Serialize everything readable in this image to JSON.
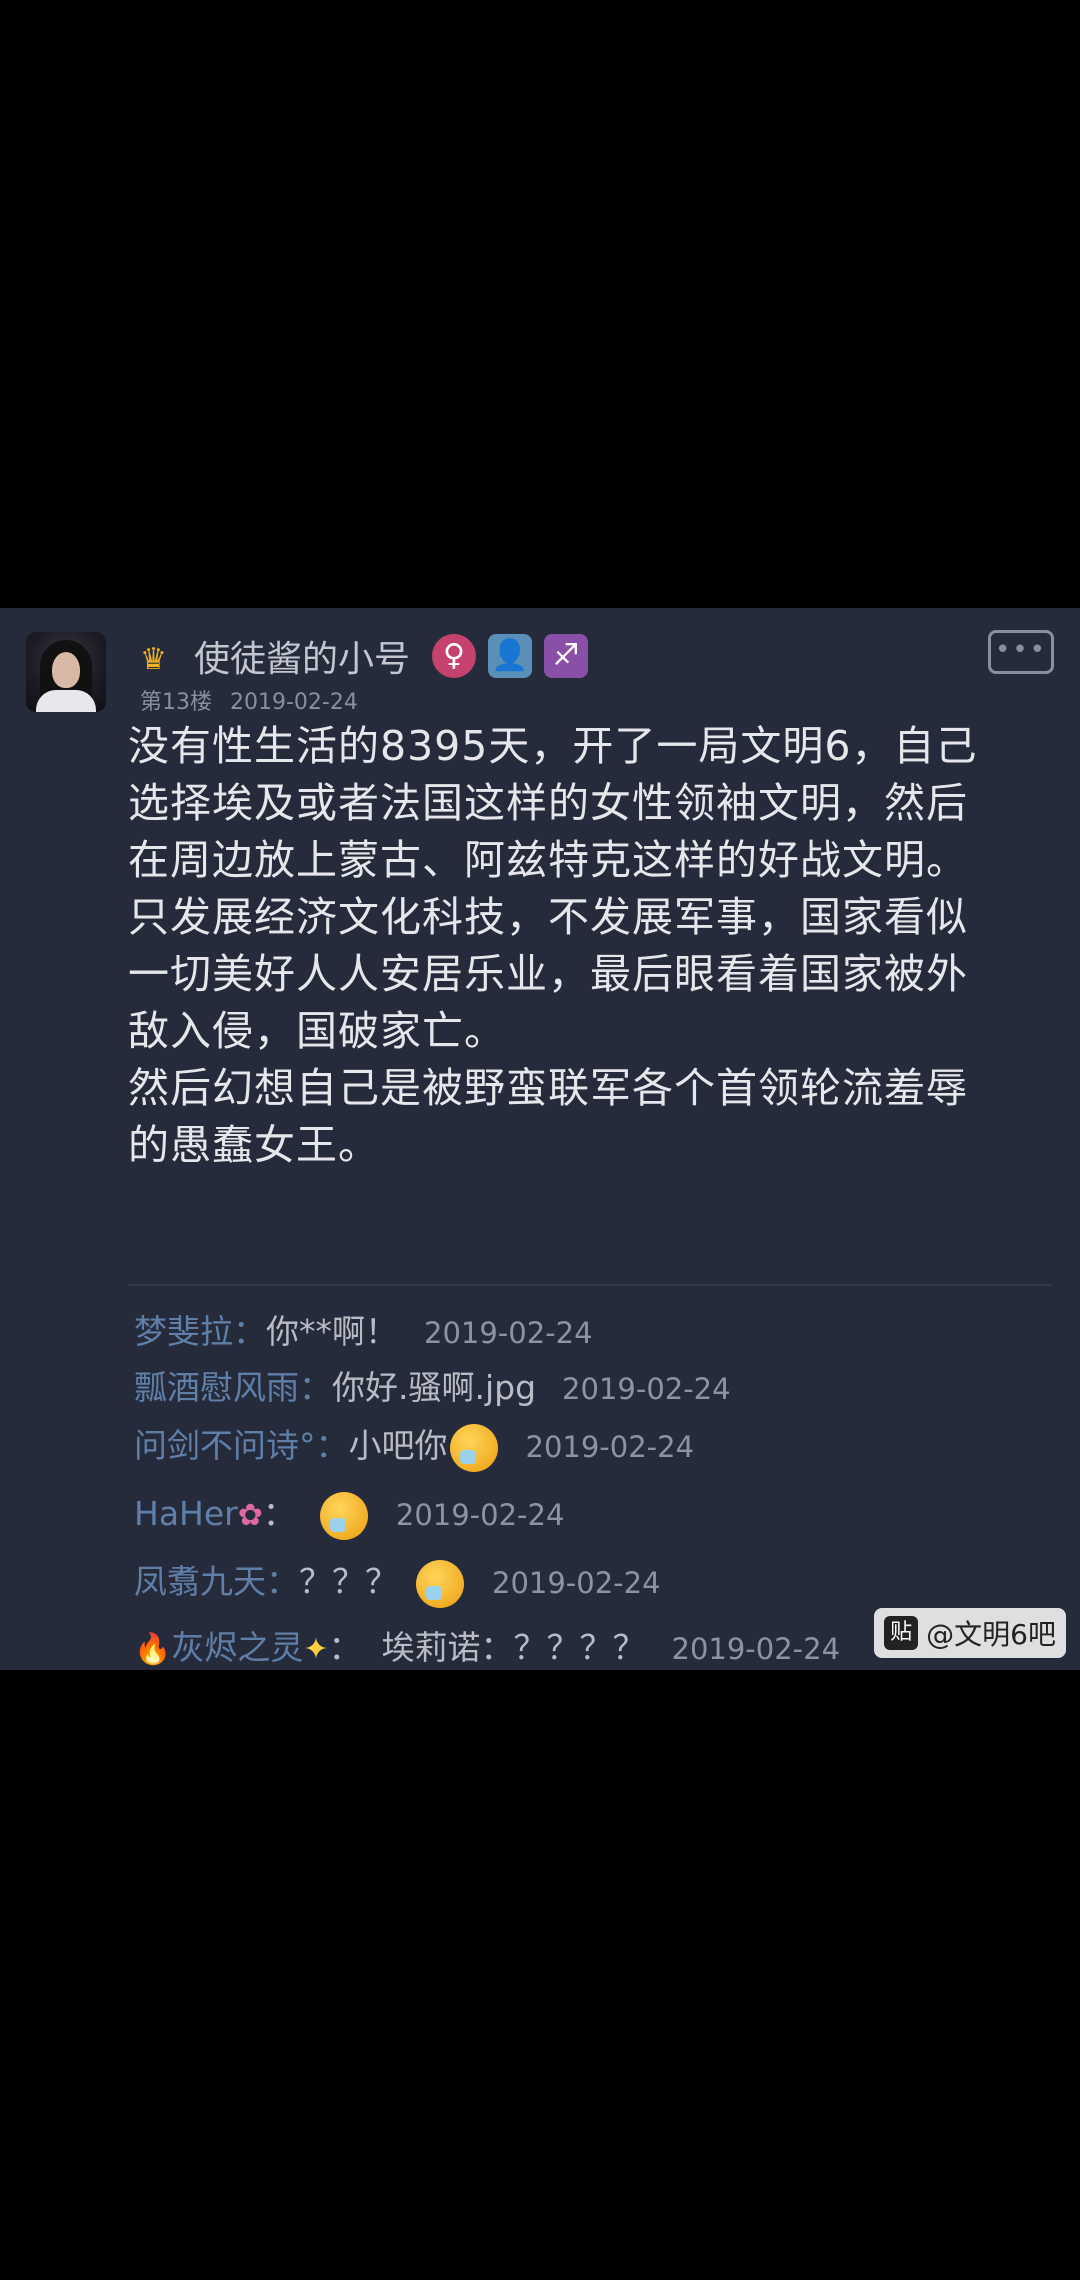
{
  "post": {
    "author": "使徒酱的小号",
    "badges": {
      "gender": "♀",
      "profile": "👤",
      "zodiac": "♐"
    },
    "floor": "第13楼",
    "date": "2019-02-24",
    "lines": [
      "没有性生活的8395天，开了一局文明6，自己",
      "选择埃及或者法国这样的女性领袖文明，然后",
      "在周边放上蒙古、阿兹特克这样的好战文明。",
      "只发展经济文化科技，不发展军事，国家看似",
      "一切美好人人安居乐业，最后眼看着国家被外",
      "敌入侵，国破家亡。",
      "然后幻想自己是被野蛮联军各个首领轮流羞辱",
      "的愚蠢女王。"
    ],
    "more_label": "•••"
  },
  "comments": [
    {
      "name": "梦斐拉：",
      "text": "你**啊！",
      "date": "2019-02-24"
    },
    {
      "name": "瓢酒慰风雨：",
      "text": "你好.骚啊.jpg",
      "date": "2019-02-24"
    },
    {
      "name": "问剑不问诗°：",
      "text": "小吧你",
      "date": "2019-02-24"
    },
    {
      "name": "HaHer",
      "sep": "：",
      "date": "2019-02-24"
    },
    {
      "name": "凤翥九天：",
      "text": "？？？",
      "date": "2019-02-24"
    },
    {
      "name": "灰烬之灵",
      "sep": "：",
      "text": "埃莉诺：？？？？",
      "date": "2019-02-24"
    }
  ],
  "watermark": {
    "icon": "贴",
    "text": "@文明6吧"
  }
}
